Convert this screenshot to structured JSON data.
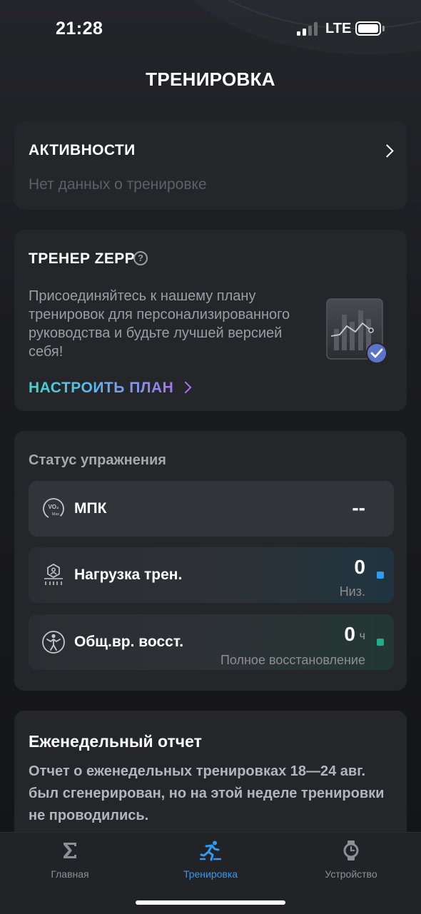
{
  "status_bar": {
    "time": "21:28",
    "network": "LTE",
    "icons": [
      "signal-icon",
      "battery-icon"
    ]
  },
  "header": {
    "title": "ТРЕНИРОВКА"
  },
  "activities": {
    "title": "АКТИВНОСТИ",
    "empty_text": "Нет данных о тренировке"
  },
  "coach": {
    "title": "ТРЕНЕР ZEPP",
    "help_icon": "?",
    "description": "Присоединяйтесь к нашему плану тренировок для персонализированного руководства и будьте лучшей версией себя!",
    "action": "НАСТРОИТЬ ПЛАН"
  },
  "exercise_status": {
    "title": "Статус упражнения",
    "metrics": [
      {
        "label": "МПК",
        "value": "--",
        "icon": "vo2max-icon"
      },
      {
        "label": "Нагрузка трен.",
        "value": "0",
        "sub": "Низ.",
        "indicator_color": "#2f9bf2",
        "icon": "training-load-icon"
      },
      {
        "label": "Общ.вр. восст.",
        "value": "0",
        "unit": "ч",
        "sub": "Полное восстановление",
        "indicator_color": "#1fae8a",
        "icon": "recovery-icon"
      }
    ]
  },
  "weekly_report": {
    "title": "Еженедельный отчет",
    "text": "Отчет о еженедельных тренировках 18—24 авг. был сгенерирован, но на этой неделе тренировки не проводились."
  },
  "tabbar": {
    "tabs": [
      {
        "label": "Главная",
        "icon": "sigma-icon",
        "active": false
      },
      {
        "label": "Тренировка",
        "icon": "running-icon",
        "active": true
      },
      {
        "label": "Устройство",
        "icon": "watch-icon",
        "active": false
      }
    ]
  },
  "colors": {
    "accent_blue": "#2f9bf2",
    "accent_green": "#1fae8a",
    "gradient_start": "#3fd7d0",
    "gradient_end": "#a673f3"
  }
}
